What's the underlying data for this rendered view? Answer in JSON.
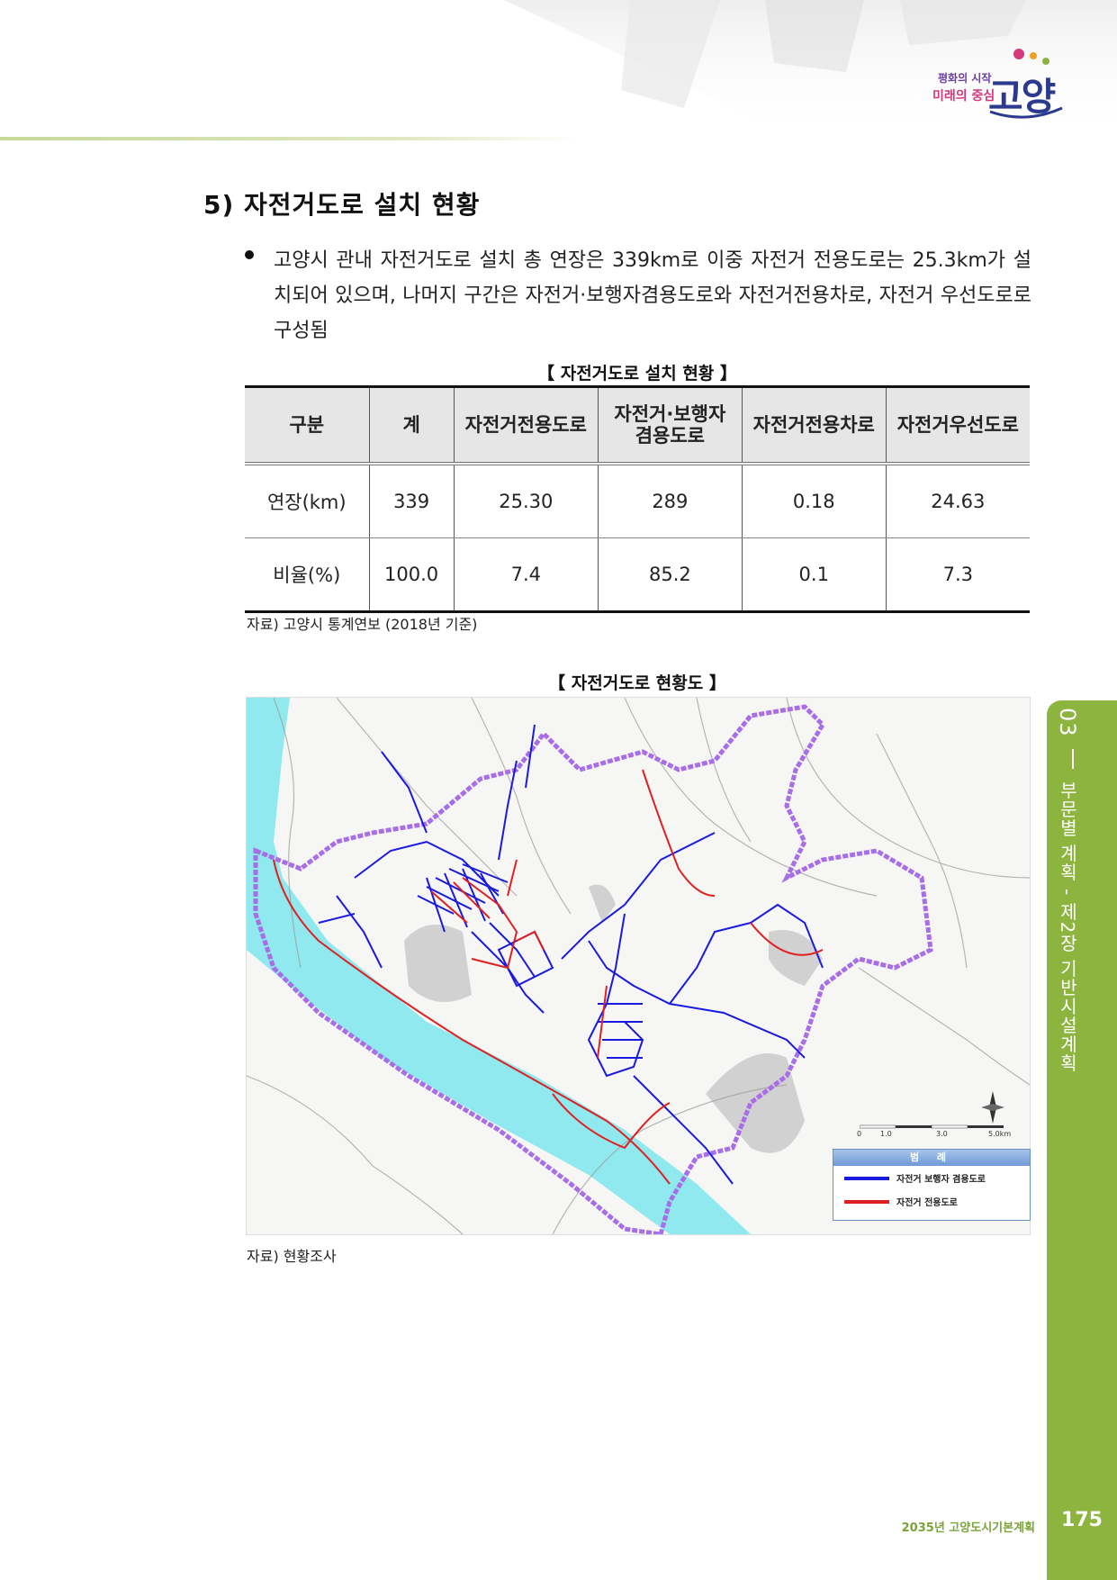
{
  "header": {
    "logo_tag1": "평화의 시작",
    "logo_tag2": "미래의 중심",
    "logo_word": "고양"
  },
  "section": {
    "title": "5) 자전거도로 설치 현황",
    "bullet": "고양시 관내 자전거도로 설치 총 연장은 339km로 이중 자전거 전용도로는 25.3km가 설치되어 있으며, 나머지 구간은 자전거·보행자겸용도로와 자전거전용차로, 자전거 우선도로로 구성됨"
  },
  "table": {
    "caption": "【 자전거도로 설치 현황 】",
    "headers": [
      "구분",
      "계",
      "자전거전용도로",
      "자전거·보행자\n겸용도로",
      "자전거전용차로",
      "자전거우선도로"
    ],
    "rows": [
      [
        "연장(km)",
        "339",
        "25.30",
        "289",
        "0.18",
        "24.63"
      ],
      [
        "비율(%)",
        "100.0",
        "7.4",
        "85.2",
        "0.1",
        "7.3"
      ]
    ],
    "source": "자료) 고양시 통계연보 (2018년 기준)"
  },
  "figure": {
    "caption": "【 자전거도로 현황도 】",
    "source": "자료) 현황조사",
    "legend": {
      "title": "범 례",
      "items": [
        {
          "label": "자전거 보행자 겸용도로",
          "color": "#1a1adf"
        },
        {
          "label": "자전거 전용도로",
          "color": "#e02020"
        }
      ]
    },
    "scale_labels": [
      "0",
      "1.0",
      "3.0",
      "5.0km"
    ]
  },
  "side": {
    "chapter_num": "03",
    "chapter_text": "부문별 계획 - 제2장 기반시설계획"
  },
  "footer": {
    "doc_title": "2035년 고양도시기본계획",
    "page_number": "175"
  },
  "colors": {
    "accent_green": "#8db43f",
    "boundary_purple": "#a86ee8",
    "river": "#8fe9ee"
  }
}
